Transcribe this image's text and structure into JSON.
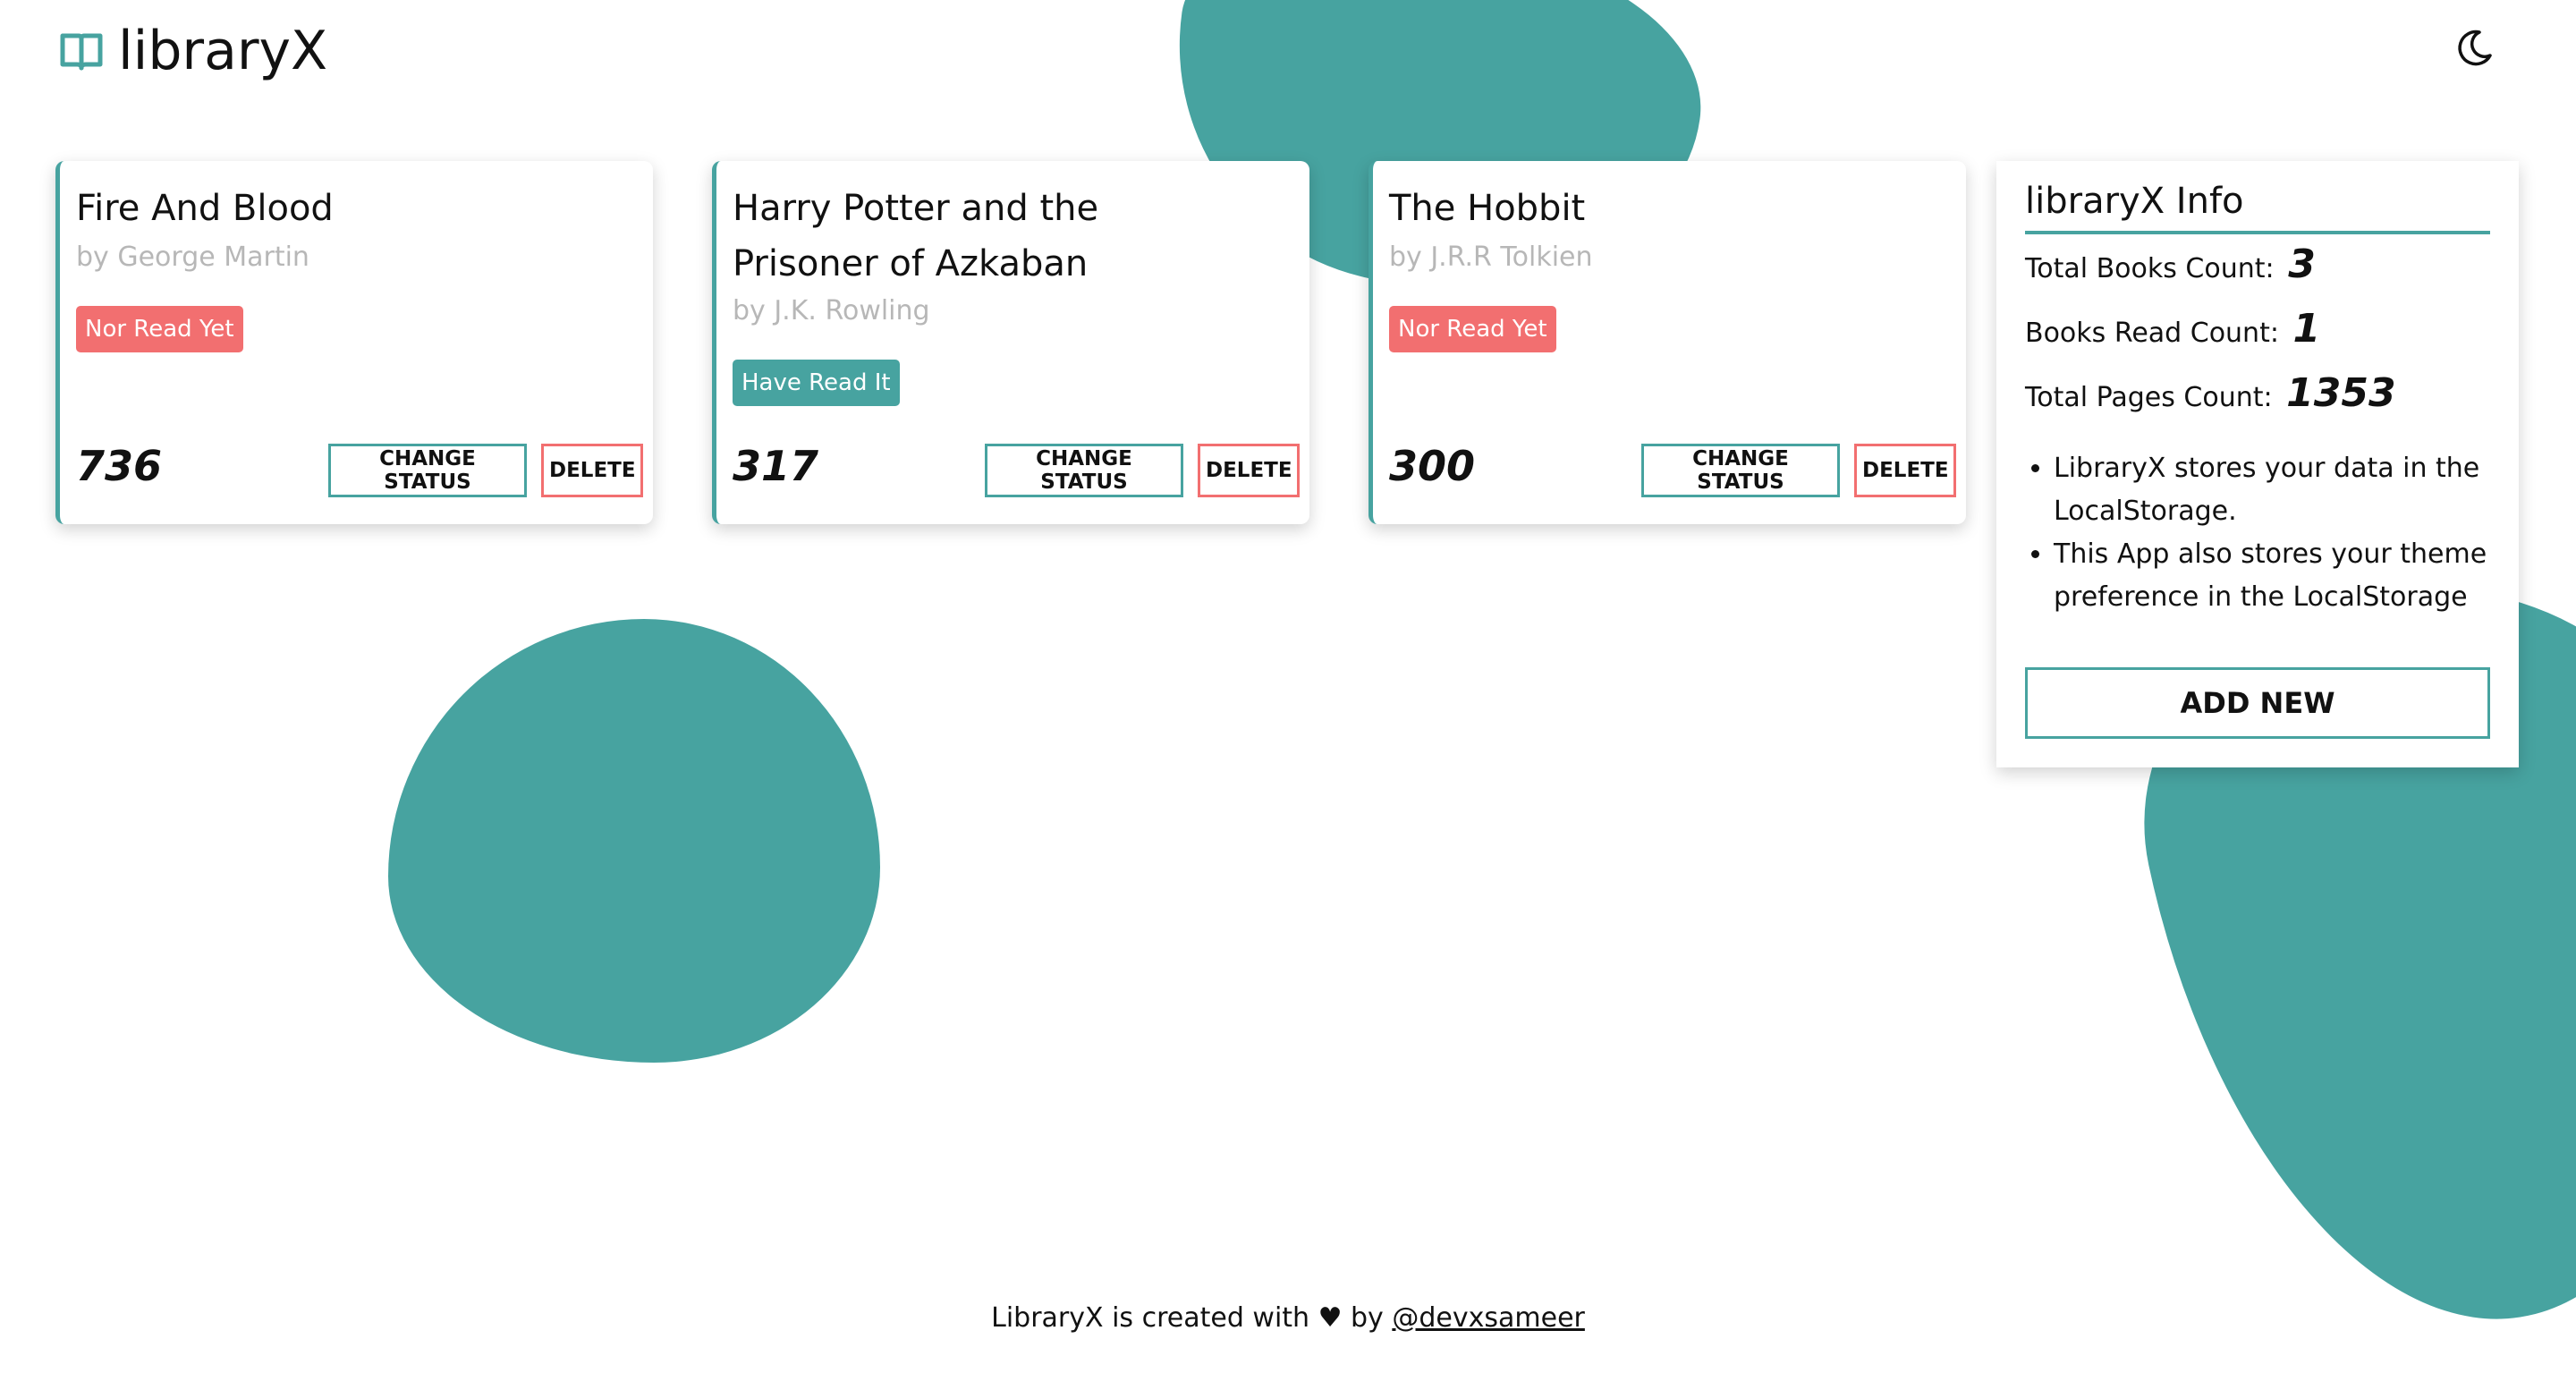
{
  "app": {
    "title": "libraryX"
  },
  "colors": {
    "accent": "#47a3a0",
    "danger": "#f26f70",
    "text": "#111111",
    "muted": "#b7b7b7"
  },
  "icons": {
    "logo": "open-book-icon",
    "theme_toggle": "moon-icon"
  },
  "books": [
    {
      "title": "Fire And Blood",
      "author": "by George Martin",
      "status": "Nor Read Yet",
      "read": false,
      "pages": "736",
      "change_status_label": "CHANGE STATUS",
      "delete_label": "DELETE"
    },
    {
      "title": "Harry Potter and the Prisoner of Azkaban",
      "author": "by J.K. Rowling",
      "status": "Have Read It",
      "read": true,
      "pages": "317",
      "change_status_label": "CHANGE STATUS",
      "delete_label": "DELETE"
    },
    {
      "title": "The Hobbit",
      "author": "by J.R.R Tolkien",
      "status": "Nor Read Yet",
      "read": false,
      "pages": "300",
      "change_status_label": "CHANGE STATUS",
      "delete_label": "DELETE"
    }
  ],
  "info": {
    "title": "libraryX Info",
    "total_books_label": "Total Books Count:",
    "total_books": "3",
    "books_read_label": "Books Read Count:",
    "books_read": "1",
    "total_pages_label": "Total Pages Count:",
    "total_pages": "1353",
    "notes": [
      "LibraryX stores your data in the LocalStorage.",
      "This App also stores your theme preference in the LocalStorage"
    ],
    "add_new_label": "ADD NEW"
  },
  "footer": {
    "text": "LibraryX is created with ♥ by",
    "link": "@devxsameer"
  }
}
